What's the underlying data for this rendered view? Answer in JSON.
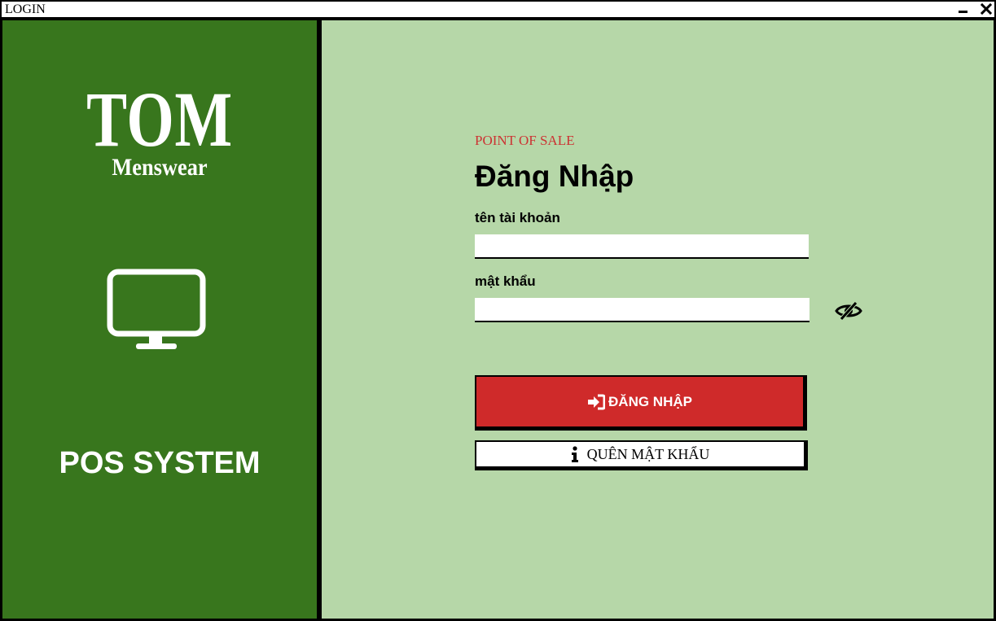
{
  "window": {
    "title": "LOGIN",
    "minimize_icon": "minimize-icon",
    "close_icon": "close-icon"
  },
  "left": {
    "brand_main": "TOM",
    "brand_sub": "Menswear",
    "icon": "monitor-icon",
    "system_label": "POS SYSTEM"
  },
  "form": {
    "eyebrow": "POINT OF SALE",
    "title": "Đăng Nhập",
    "username_label": "tên tài khoản",
    "username_value": "",
    "password_label": "mật khẩu",
    "password_value": "",
    "toggle_icon": "eye-slash-icon",
    "login_button": "ĐĂNG NHẬP",
    "login_icon": "sign-in-icon",
    "forgot_button": "QUÊN MẬT KHẨU",
    "forgot_icon": "info-icon"
  },
  "colors": {
    "sidebar": "#38761d",
    "content": "#b6d7a8",
    "accent": "#cf2a2a",
    "eyebrow": "#cc3333"
  }
}
